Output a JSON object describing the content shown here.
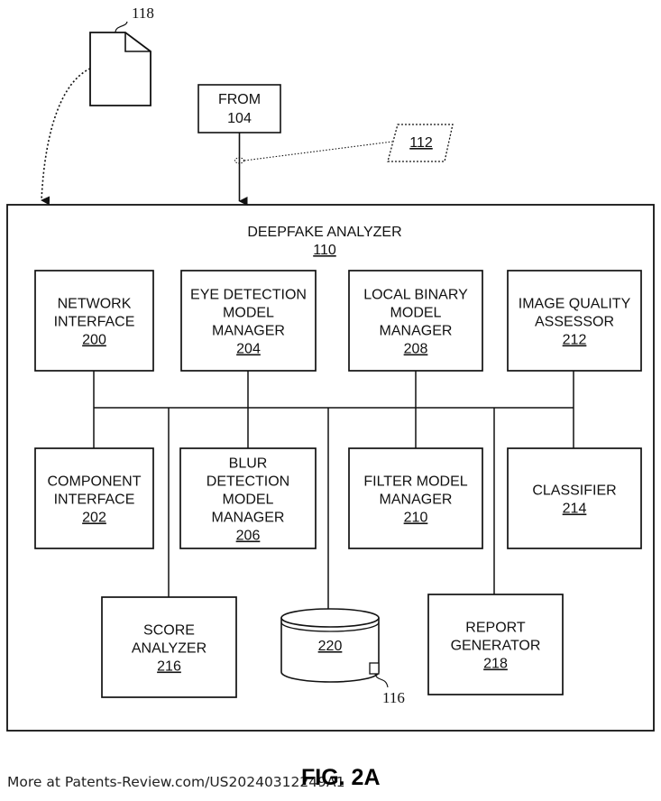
{
  "diagram": {
    "document_ref": "118",
    "source_box": {
      "line1": "FROM",
      "line2": "104"
    },
    "input_ref": "112",
    "container": {
      "title": "DEEPFAKE ANALYZER",
      "ref": "110"
    },
    "components": [
      {
        "id": "network-interface",
        "lines": [
          "NETWORK",
          "INTERFACE"
        ],
        "ref": "200"
      },
      {
        "id": "eye-detection-model-manager",
        "lines": [
          "EYE DETECTION",
          "MODEL",
          "MANAGER"
        ],
        "ref": "204"
      },
      {
        "id": "local-binary-model-manager",
        "lines": [
          "LOCAL BINARY",
          "MODEL",
          "MANAGER"
        ],
        "ref": "208"
      },
      {
        "id": "image-quality-assessor",
        "lines": [
          "IMAGE QUALITY",
          "ASSESSOR"
        ],
        "ref": "212"
      },
      {
        "id": "component-interface",
        "lines": [
          "COMPONENT",
          "INTERFACE"
        ],
        "ref": "202"
      },
      {
        "id": "blur-detection-model-manager",
        "lines": [
          "BLUR",
          "DETECTION",
          "MODEL",
          "MANAGER"
        ],
        "ref": "206"
      },
      {
        "id": "filter-model-manager",
        "lines": [
          "FILTER MODEL",
          "MANAGER"
        ],
        "ref": "210"
      },
      {
        "id": "classifier",
        "lines": [
          "CLASSIFIER"
        ],
        "ref": "214"
      },
      {
        "id": "score-analyzer",
        "lines": [
          "SCORE",
          "ANALYZER"
        ],
        "ref": "216"
      },
      {
        "id": "report-generator",
        "lines": [
          "REPORT",
          "GENERATOR"
        ],
        "ref": "218"
      }
    ],
    "database": {
      "ref": "220",
      "item_ref": "116"
    }
  },
  "footer": {
    "source_text": "More at Patents-Review.com/US20240312249A1",
    "figure_label": "FIG. 2A"
  }
}
